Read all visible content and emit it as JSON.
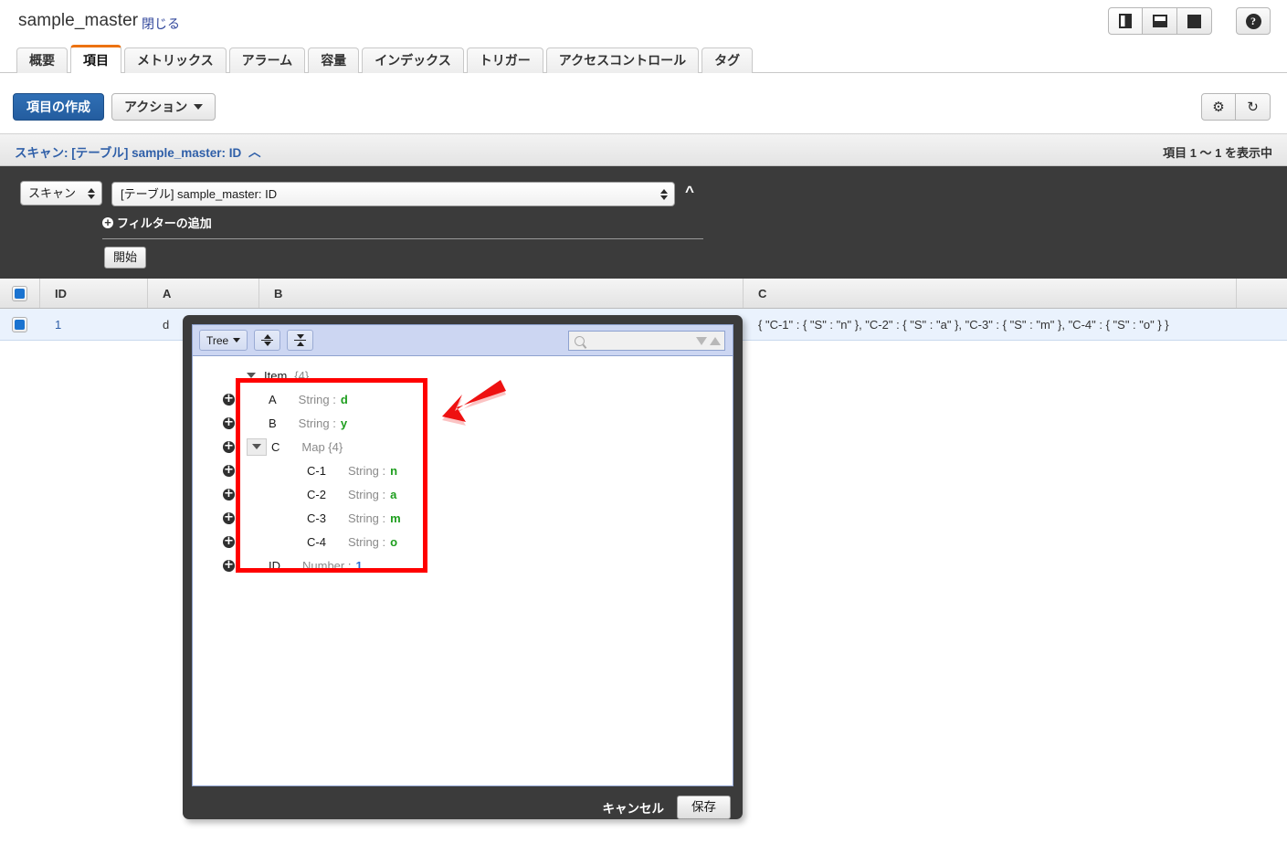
{
  "header": {
    "table_name": "sample_master",
    "close_label": "閉じる",
    "layout_buttons": [
      {
        "name": "split-vertical",
        "icon": "split-vertical-icon",
        "active": true
      },
      {
        "name": "split-horizontal",
        "icon": "split-horizontal-icon",
        "active": false
      },
      {
        "name": "no-split",
        "icon": "full-pane-icon",
        "active": false
      }
    ],
    "help_label": "?"
  },
  "tabs": [
    {
      "label": "概要",
      "selected": false
    },
    {
      "label": "項目",
      "selected": true
    },
    {
      "label": "メトリックス",
      "selected": false
    },
    {
      "label": "アラーム",
      "selected": false
    },
    {
      "label": "容量",
      "selected": false
    },
    {
      "label": "インデックス",
      "selected": false
    },
    {
      "label": "トリガー",
      "selected": false
    },
    {
      "label": "アクセスコントロール",
      "selected": false
    },
    {
      "label": "タグ",
      "selected": false
    }
  ],
  "actionbar": {
    "create_item_label": "項目の作成",
    "actions_label": "アクション",
    "settings_icon": "gear-icon",
    "refresh_icon": "refresh-icon"
  },
  "scan_header": {
    "title": "スキャン: [テーブル] sample_master: ID",
    "chevron": "︿",
    "count_label": "項目 1 〜 1 を表示中"
  },
  "scan_panel": {
    "operation": "スキャン",
    "target": "[テーブル] sample_master: ID",
    "add_filter_label": "フィルターの追加",
    "add_filter_icon": "plus-circle-icon",
    "start_label": "開始",
    "collapse_icon": "chevron-up-icon"
  },
  "table": {
    "columns": [
      "ID",
      "A",
      "B",
      "C"
    ],
    "rows": [
      {
        "selected": true,
        "ID": "1",
        "A": "d",
        "B": "",
        "C": "{ \"C-1\" : { \"S\" : \"n\" }, \"C-2\" : { \"S\" : \"a\" }, \"C-3\" : { \"S\" : \"m\" }, \"C-4\" : { \"S\" : \"o\" } }"
      }
    ]
  },
  "editor_dialog": {
    "view_mode_label": "Tree",
    "expand_all_icon": "expand-all-icon",
    "collapse_all_icon": "collapse-all-icon",
    "search_placeholder": "",
    "search_value": "",
    "search_icon": "search-icon",
    "next_match_icon": "triangle-down-icon",
    "prev_match_icon": "triangle-up-icon",
    "cancel_label": "キャンセル",
    "save_label": "保存",
    "tree": [
      {
        "indent": "item",
        "twisty": "open",
        "key": "Item",
        "type": "{4}",
        "value": "",
        "value_kind": "none",
        "addable": false
      },
      {
        "indent": "lvl1",
        "twisty": "none",
        "key": "A",
        "type": "String :",
        "value": "d",
        "value_kind": "string",
        "addable": true
      },
      {
        "indent": "lvl1",
        "twisty": "none",
        "key": "B",
        "type": "String :",
        "value": "y",
        "value_kind": "string",
        "addable": true
      },
      {
        "indent": "lvl1",
        "twisty": "open-box",
        "key": "C",
        "type": "Map  {4}",
        "value": "",
        "value_kind": "none",
        "addable": true
      },
      {
        "indent": "lvl2",
        "twisty": "none",
        "key": "C-1",
        "type": "String :",
        "value": "n",
        "value_kind": "string",
        "addable": true
      },
      {
        "indent": "lvl2",
        "twisty": "none",
        "key": "C-2",
        "type": "String :",
        "value": "a",
        "value_kind": "string",
        "addable": true
      },
      {
        "indent": "lvl2",
        "twisty": "none",
        "key": "C-3",
        "type": "String :",
        "value": "m",
        "value_kind": "string",
        "addable": true
      },
      {
        "indent": "lvl2",
        "twisty": "none",
        "key": "C-4",
        "type": "String :",
        "value": "o",
        "value_kind": "string",
        "addable": true
      },
      {
        "indent": "lvl1",
        "twisty": "none",
        "key": "ID",
        "type": "Number :",
        "value": "1",
        "value_kind": "number",
        "addable": true
      }
    ]
  },
  "annotations": {
    "highlight_color": "#ff0000",
    "arrow_color": "#ee1111"
  }
}
